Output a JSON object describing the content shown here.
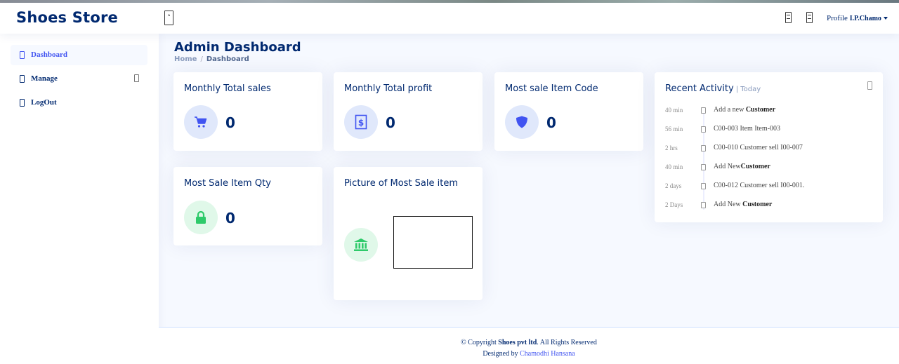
{
  "header": {
    "logo": "Shoes Store",
    "toggle_glyph": "⇆",
    "profile_label": "Profile",
    "profile_name": "I.P.Chamo"
  },
  "sidebar": {
    "items": [
      {
        "label": "Dashboard",
        "icon": "grid-icon"
      },
      {
        "label": "Manage",
        "icon": "menu-icon"
      },
      {
        "label": "LogOut",
        "icon": "logout-icon"
      }
    ]
  },
  "page": {
    "title": "Admin Dashboard",
    "breadcrumb": {
      "home": "Home",
      "sep": "/",
      "current": "Dashboard"
    }
  },
  "cards": {
    "sales": {
      "title": "Monthly Total sales",
      "value": "0",
      "icon": "cart-icon"
    },
    "profit": {
      "title": "Monthly Total profit",
      "value": "0",
      "icon": "currency-icon"
    },
    "item_code": {
      "title": "Most sale Item Code",
      "value": "0",
      "icon": "shield-icon"
    },
    "item_qty": {
      "title": "Most Sale Item Qty",
      "value": "0",
      "icon": "lock-icon"
    },
    "picture": {
      "title": "Picture of Most Sale item",
      "icon": "bank-icon"
    }
  },
  "activity": {
    "title": "Recent Activity",
    "sep": "|",
    "today": "Today",
    "items": [
      {
        "time": "40 min",
        "text": "Add a new ",
        "bold": "Customer"
      },
      {
        "time": "56 min",
        "text": "C00-003 Item Item-003",
        "bold": ""
      },
      {
        "time": "2 hrs",
        "text": "C00-010 Customer sell I00-007",
        "bold": ""
      },
      {
        "time": "40 min",
        "text": "Add New",
        "bold": "Customer"
      },
      {
        "time": "2 days",
        "text": "C00-012 Customer sell I00-001.",
        "bold": ""
      },
      {
        "time": "2 Days",
        "text": "Add New ",
        "bold": "Customer"
      }
    ]
  },
  "footer": {
    "copyright_prefix": "© Copyright ",
    "company": "Shoes pvt ltd",
    "copyright_suffix": ". All Rights Reserved",
    "designed_by": "Designed by ",
    "designer": "Chamodhi Hansana"
  },
  "colors": {
    "primary": "#012970",
    "accent": "#4154f1",
    "icon_blue_bg": "#e0e8fb",
    "icon_green_bg": "#e0f8e9",
    "green": "#2eca6a"
  }
}
